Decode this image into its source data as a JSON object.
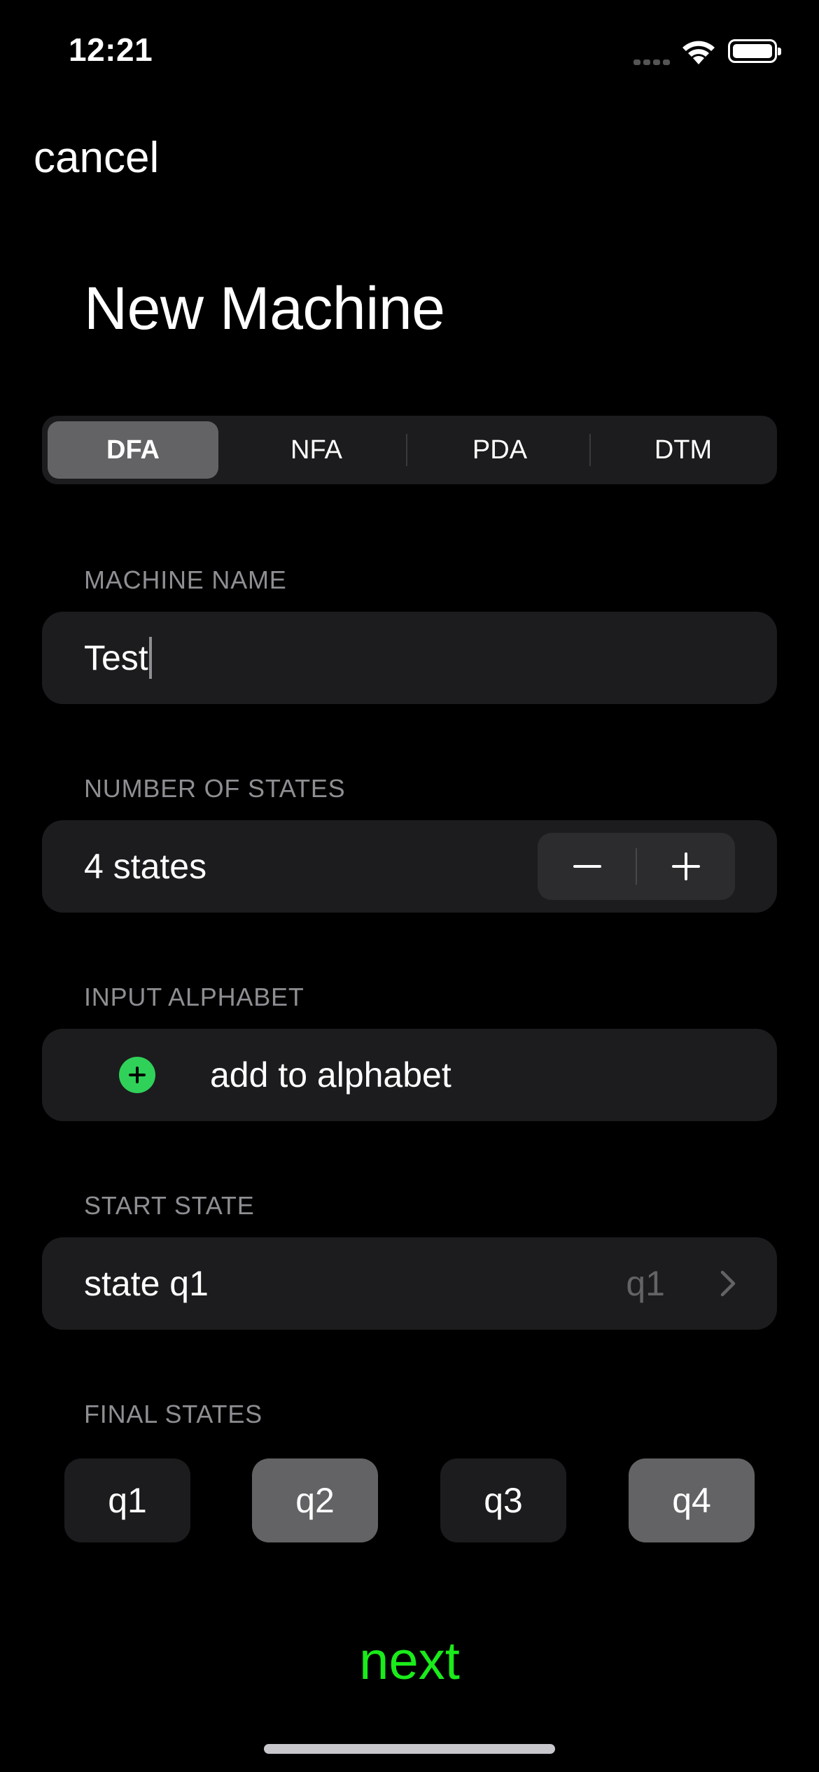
{
  "status_bar": {
    "time": "12:21"
  },
  "nav": {
    "cancel_label": "cancel"
  },
  "page": {
    "title": "New Machine"
  },
  "machine_types": {
    "options": [
      "DFA",
      "NFA",
      "PDA",
      "DTM"
    ],
    "selected": "DFA"
  },
  "machine_name": {
    "header": "MACHINE NAME",
    "value": "Test"
  },
  "number_of_states": {
    "header": "NUMBER OF STATES",
    "value_label": "4 states",
    "decrement_icon": "minus-icon",
    "increment_icon": "plus-icon"
  },
  "input_alphabet": {
    "header": "INPUT ALPHABET",
    "add_label": "add to alphabet",
    "add_icon": "plus-circle-icon",
    "add_icon_color": "#30d158"
  },
  "start_state": {
    "header": "START STATE",
    "label": "state q1",
    "value": "q1"
  },
  "final_states": {
    "header": "FINAL STATES",
    "states": [
      {
        "label": "q1",
        "selected": false
      },
      {
        "label": "q2",
        "selected": true
      },
      {
        "label": "q3",
        "selected": false
      },
      {
        "label": "q4",
        "selected": true
      }
    ]
  },
  "footer": {
    "next_label": "next",
    "next_color": "#1aeb1a"
  }
}
